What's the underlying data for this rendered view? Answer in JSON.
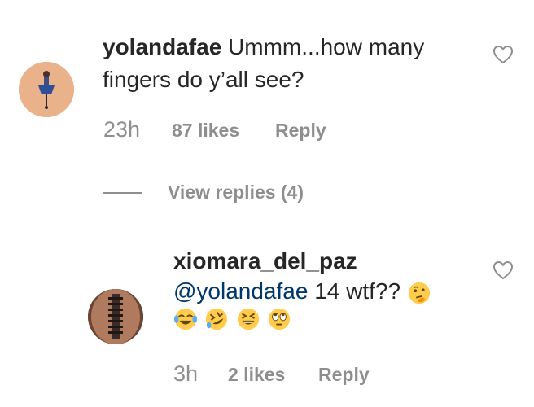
{
  "comments": [
    {
      "username": "yolandafae",
      "text": "Ummm...how many fingers do y’all see?",
      "time": "23h",
      "likes": "87 likes",
      "reply_label": "Reply",
      "view_replies": "View replies (4)"
    },
    {
      "username": "xiomara_del_paz",
      "mention": "@yolandafae",
      "text": " 14 wtf??",
      "emojis": [
        "thinking-face",
        "face-with-tears-of-joy",
        "rolling-on-the-floor-laughing",
        "grinning-squinting-face",
        "face-with-rolling-eyes"
      ],
      "time": "3h",
      "likes": "2 likes",
      "reply_label": "Reply"
    }
  ],
  "colors": {
    "text": "#262626",
    "muted": "#8e8e8e",
    "mention": "#00376b",
    "avatar1": "#e7b089",
    "avatar2": "#5a3a2c"
  }
}
